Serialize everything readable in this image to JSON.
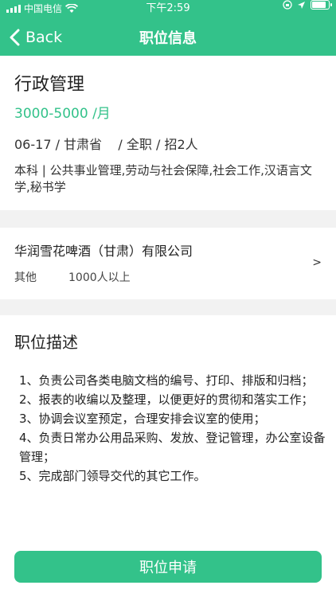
{
  "status_bar": {
    "carrier": "中国电信",
    "time": "下午2:59"
  },
  "nav": {
    "back_label": "Back",
    "title": "职位信息"
  },
  "job": {
    "title": "行政管理",
    "salary": "3000-5000 /月",
    "meta": "06-17 / 甘肃省    / 全职 / 招2人",
    "requirements": "本科 | 公共事业管理,劳动与社会保障,社会工作,汉语言文学,秘书学"
  },
  "company": {
    "name": "华润雪花啤酒（甘肃）有限公司",
    "type": "其他",
    "size": "1000人以上",
    "arrow": ">"
  },
  "description": {
    "heading": "职位描述",
    "lines": [
      "1、负责公司各类电脑文档的编号、打印、排版和归档；",
      "2、报表的收编以及整理，以便更好的贯彻和落实工作；",
      "3、协调会议室预定，合理安排会议室的使用；",
      "4、负责日常办公用品采购、发放、登记管理，办公室设备管理；",
      "5、完成部门领导交代的其它工作。"
    ]
  },
  "footer": {
    "apply_label": "职位申请"
  },
  "colors": {
    "accent": "#33c28a"
  },
  "icons": [
    "signal-icon",
    "wifi-icon",
    "lock-rotation-icon",
    "location-icon",
    "battery-icon",
    "chevron-left-icon"
  ]
}
